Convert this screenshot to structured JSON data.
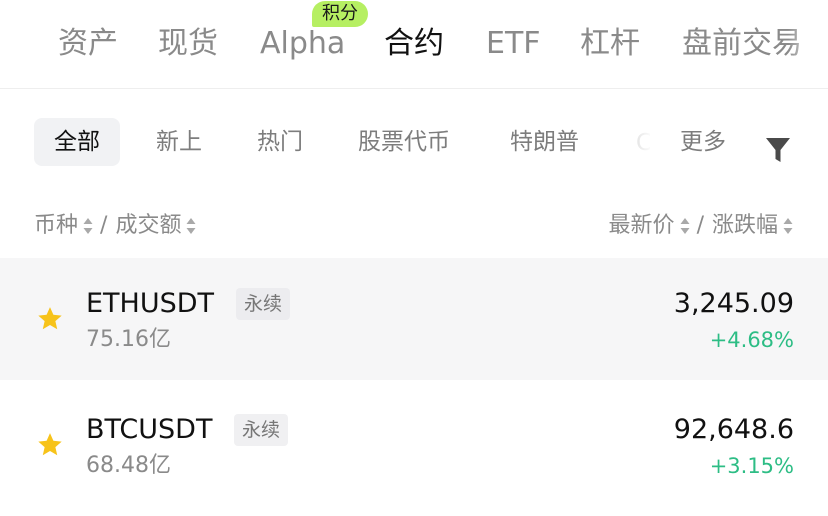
{
  "top_tabs": {
    "items": [
      {
        "label": "资产"
      },
      {
        "label": "现货"
      },
      {
        "label": "Alpha",
        "badge": "积分"
      },
      {
        "label": "合约"
      },
      {
        "label": "ETF"
      },
      {
        "label": "杠杆"
      },
      {
        "label": "盘前交易"
      }
    ],
    "active": "合约"
  },
  "filters": {
    "items": [
      "全部",
      "新上",
      "热门",
      "股票代币",
      "特朗普",
      "C"
    ],
    "active": "全部",
    "more_label": "更多",
    "filter_icon": "funnel-icon"
  },
  "columns": {
    "left_primary": "币种",
    "left_secondary": "成交额",
    "right_primary": "最新价",
    "right_secondary": "涨跌幅",
    "sort_icon": "sort-updown-icon"
  },
  "rows": [
    {
      "pair": "ETHUSDT",
      "tag": "永续",
      "volume": "75.16亿",
      "price": "3,245.09",
      "change": "+4.68%",
      "favorited": true
    },
    {
      "pair": "BTCUSDT",
      "tag": "永续",
      "volume": "68.48亿",
      "price": "92,648.6",
      "change": "+3.15%",
      "favorited": true
    }
  ],
  "colors": {
    "positive": "#2dbd85",
    "star": "#f7c31a",
    "badge": "#b6ef62",
    "highlight_row": "#f6f6f7"
  }
}
